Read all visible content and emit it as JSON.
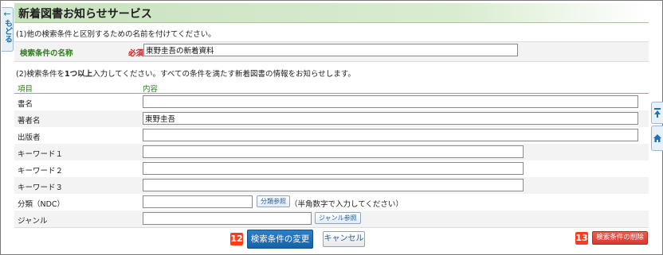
{
  "page": {
    "title": "新着図書お知らせサービス",
    "back_label": "もどる"
  },
  "step1": {
    "note": "(1)他の検索条件と区別するための名前を付けてください。",
    "label": "検索条件の名称",
    "required": "必須",
    "value": "東野圭吾の新着資料"
  },
  "step2": {
    "note_pre": "(2)検索条件を",
    "note_bold": "1つ以上",
    "note_post": "入力してください。すべての条件を満たす新着図書の情報をお知らせします。"
  },
  "table": {
    "col_item": "項目",
    "col_content": "内容",
    "rows": [
      {
        "label": "書名",
        "value": ""
      },
      {
        "label": "著者名",
        "value": "東野圭吾"
      },
      {
        "label": "出版者",
        "value": ""
      },
      {
        "label": "キーワード１",
        "value": ""
      },
      {
        "label": "キーワード２",
        "value": ""
      },
      {
        "label": "キーワード３",
        "value": ""
      },
      {
        "label": "分類（NDC）",
        "value": ""
      },
      {
        "label": "ジャンル",
        "value": ""
      }
    ],
    "ndc_button": "分類参照",
    "ndc_hint": "（半角数字で入力してください）",
    "genre_button": "ジャンル参照"
  },
  "actions": {
    "badge_change": "12",
    "change_label": "検索条件の変更",
    "cancel_label": "キャンセル",
    "badge_delete": "13",
    "delete_label": "検索条件の削除"
  },
  "colors": {
    "title_bg": "#c9e2bf",
    "label_green": "#2e7d1e",
    "required_red": "#d2161b",
    "primary_blue": "#1762a8",
    "delete_red": "#d63a30",
    "badge_red": "#ff3b1f"
  },
  "icons": {
    "back": "arrow-left-icon",
    "page_top": "page-top-icon",
    "home": "home-icon"
  }
}
